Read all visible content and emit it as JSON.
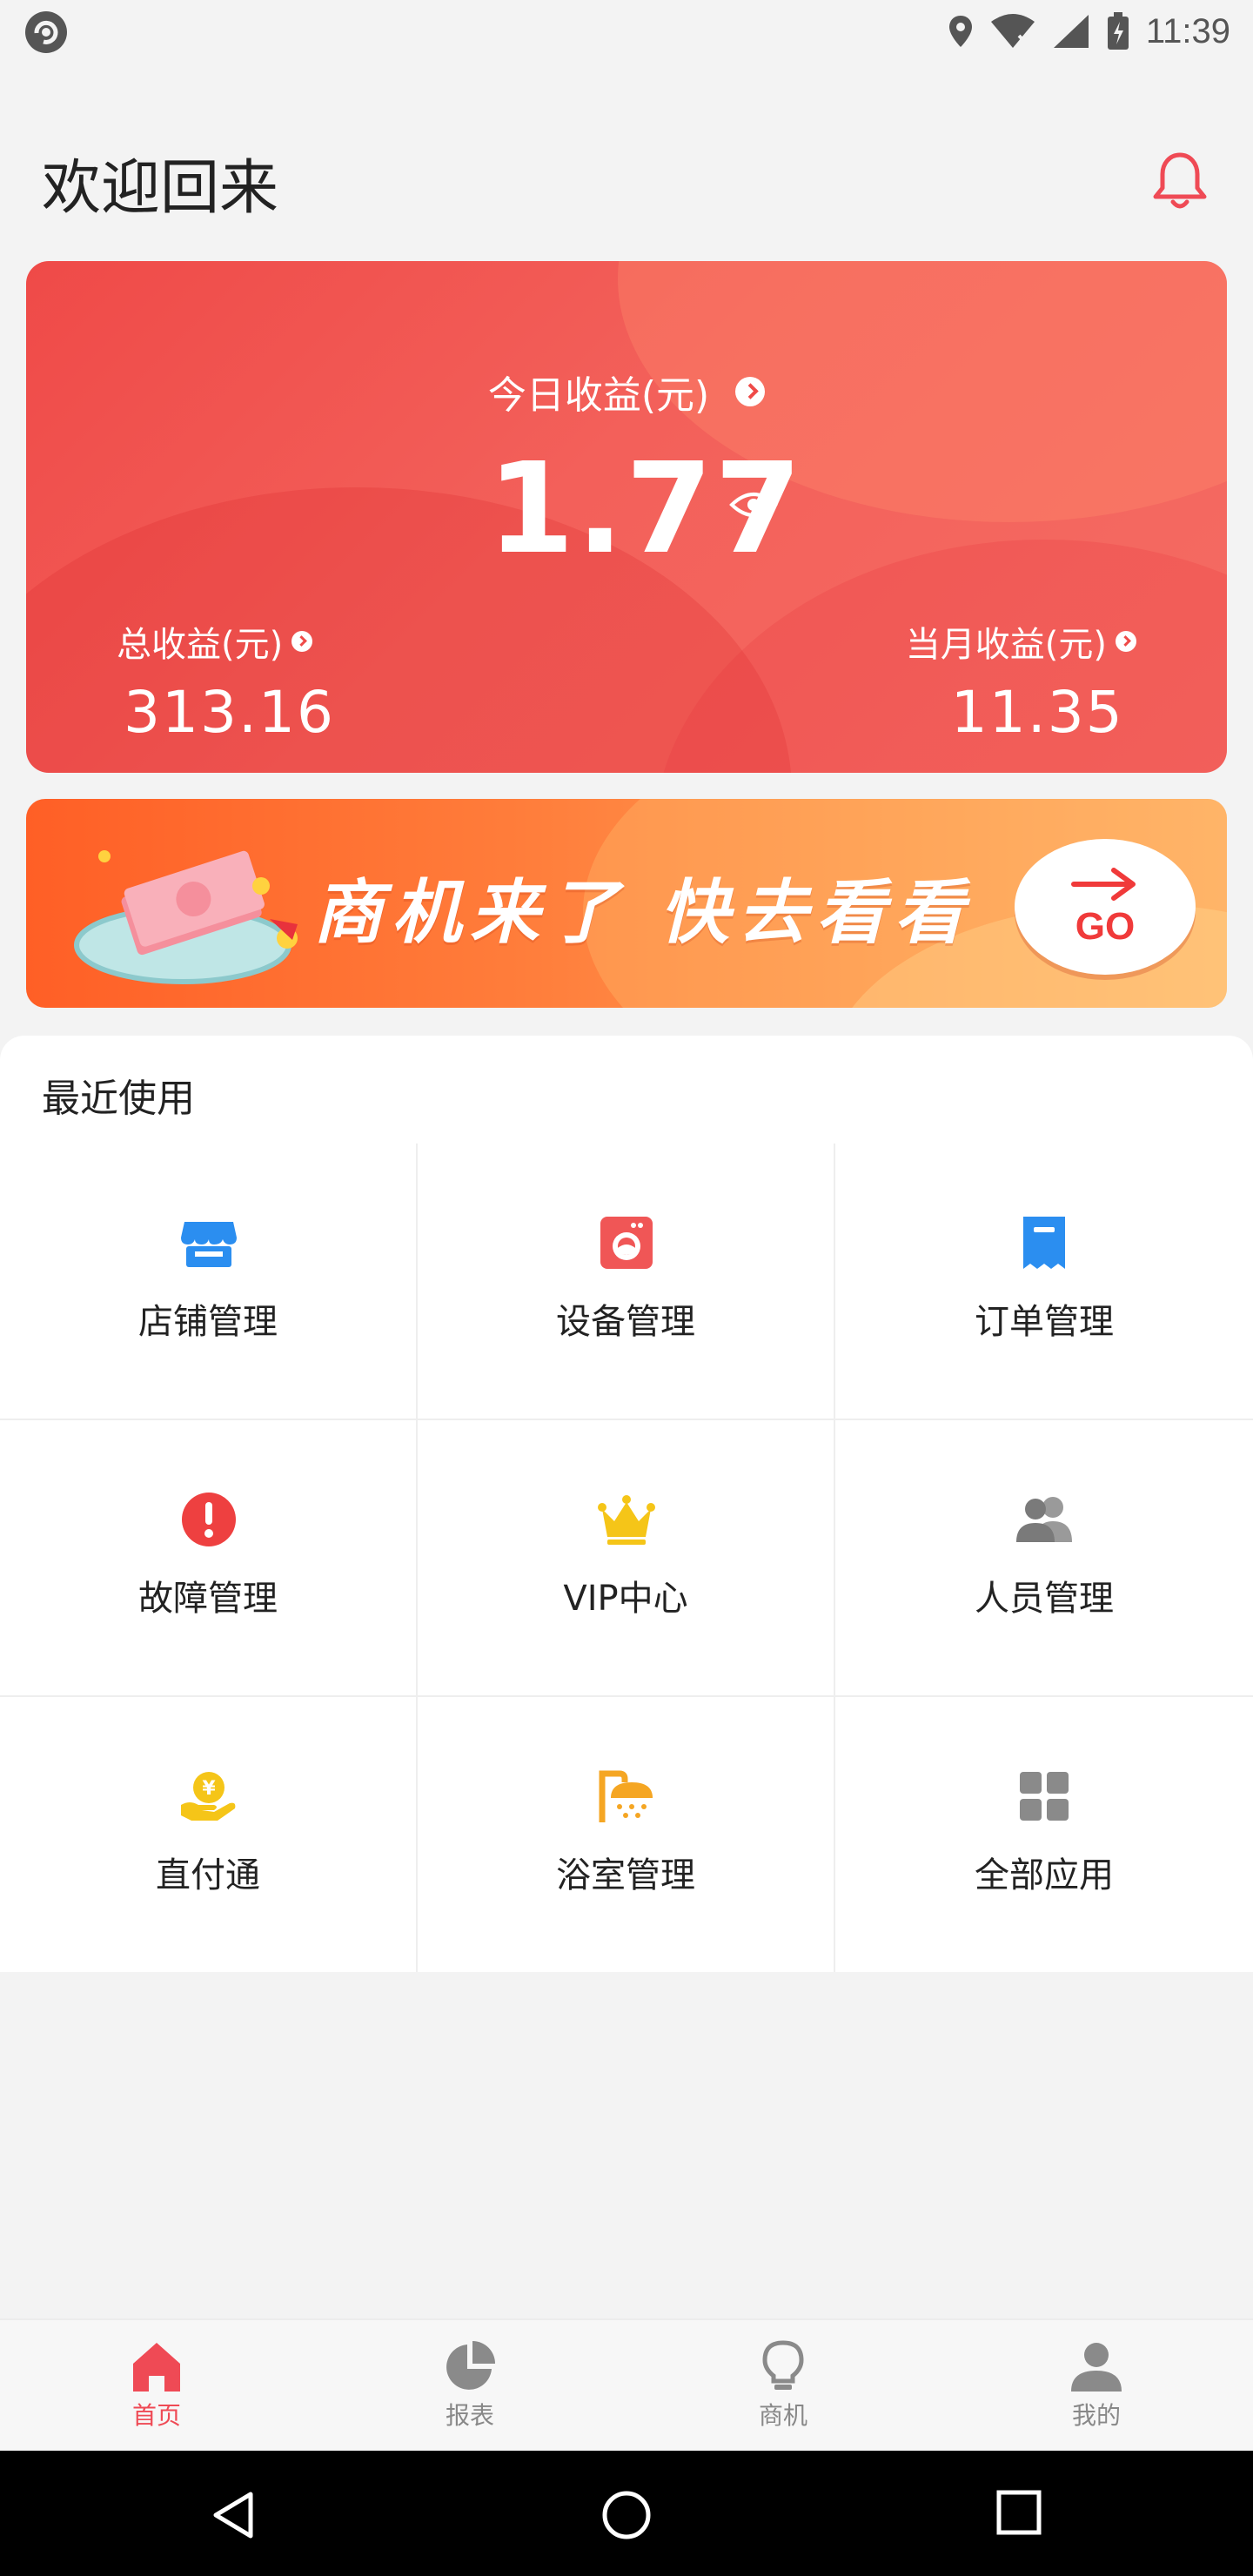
{
  "status_bar": {
    "time": "11:39",
    "icons": [
      "app-icon",
      "location-icon",
      "wifi-icon",
      "signal-icon",
      "battery-icon"
    ]
  },
  "header": {
    "title": "欢迎回来",
    "bell_icon": "bell-icon"
  },
  "earnings": {
    "today_label": "今日收益(元)",
    "today_value": "1.77",
    "total_label": "总收益(元)",
    "total_value": "313.16",
    "month_label": "当月收益(元)",
    "month_value": "11.35"
  },
  "banner": {
    "text": "商机来了 快去看看",
    "go_label": "GO"
  },
  "recent": {
    "title": "最近使用",
    "items": [
      {
        "label": "店铺管理",
        "icon": "store-icon",
        "color": "#2b8ef0"
      },
      {
        "label": "设备管理",
        "icon": "washing-machine-icon",
        "color": "#f05656"
      },
      {
        "label": "订单管理",
        "icon": "receipt-icon",
        "color": "#2b8ef0"
      },
      {
        "label": "故障管理",
        "icon": "alert-icon",
        "color": "#ee4040"
      },
      {
        "label": "VIP中心",
        "icon": "crown-icon",
        "color": "#f5c518"
      },
      {
        "label": "人员管理",
        "icon": "people-icon",
        "color": "#888888"
      },
      {
        "label": "直付通",
        "icon": "coin-hand-icon",
        "color": "#f5c518"
      },
      {
        "label": "浴室管理",
        "icon": "shower-icon",
        "color": "#f5a623"
      },
      {
        "label": "全部应用",
        "icon": "grid-apps-icon",
        "color": "#888888"
      }
    ]
  },
  "bottom_nav": {
    "items": [
      {
        "label": "首页",
        "icon": "home-icon",
        "active": true
      },
      {
        "label": "报表",
        "icon": "pie-chart-icon",
        "active": false
      },
      {
        "label": "商机",
        "icon": "lightbulb-icon",
        "active": false
      },
      {
        "label": "我的",
        "icon": "person-icon",
        "active": false
      }
    ]
  },
  "colors": {
    "accent": "#ef4a48",
    "banner": "#ff7c3a",
    "nav_active": "#ef4a55",
    "nav_inactive": "#888888"
  }
}
